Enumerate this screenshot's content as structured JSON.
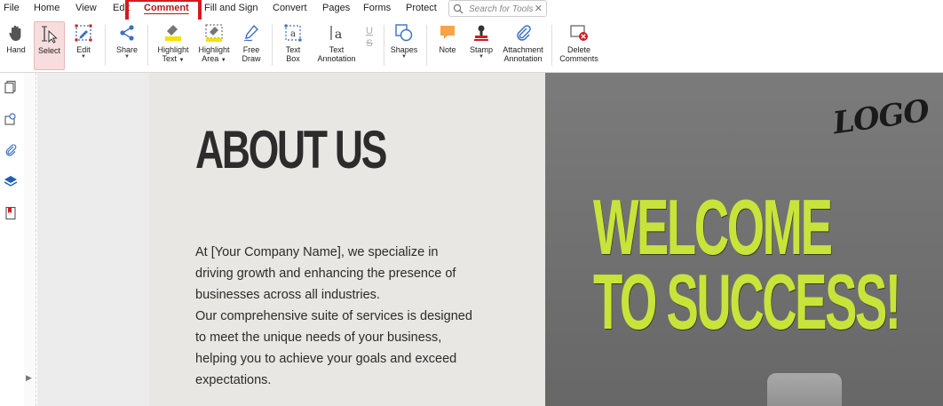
{
  "menu": {
    "items": [
      "File",
      "Home",
      "View",
      "Edit",
      "Comment",
      "Fill and Sign",
      "Convert",
      "Pages",
      "Forms",
      "Protect"
    ],
    "active": "Comment"
  },
  "search": {
    "placeholder": "Search for Tools",
    "clear_symbol": "✕"
  },
  "toolbar": {
    "hand": "Hand",
    "select": "Select",
    "edit": "Edit",
    "share": "Share",
    "highlight_text": [
      "Highlight",
      "Text"
    ],
    "highlight_area": [
      "Highlight",
      "Area"
    ],
    "free_draw": [
      "Free",
      "Draw"
    ],
    "text_box": [
      "Text",
      "Box"
    ],
    "text_annotation": [
      "Text",
      "Annotation"
    ],
    "underline_symbol": "U",
    "strike_symbol": "S",
    "shapes": "Shapes",
    "note": "Note",
    "stamp": "Stamp",
    "attachment_annotation": [
      "Attachment",
      "Annotation"
    ],
    "delete_comments": [
      "Delete",
      "Comments"
    ]
  },
  "colors": {
    "accent_red": "#d7191f",
    "welcome_green": "#c8e43b"
  },
  "document": {
    "about_title": "ABOUT US",
    "paragraph_lines": [
      "At [Your Company Name], we specialize in",
      "driving growth and enhancing the presence of",
      "businesses across all industries.",
      "Our comprehensive suite of services is designed",
      "to meet the unique needs of your business,",
      "helping you to achieve your goals and exceed",
      "expectations."
    ],
    "logo_text": "LOGO",
    "welcome_lines": [
      "WELCOME",
      "TO SUCCESS!"
    ]
  }
}
